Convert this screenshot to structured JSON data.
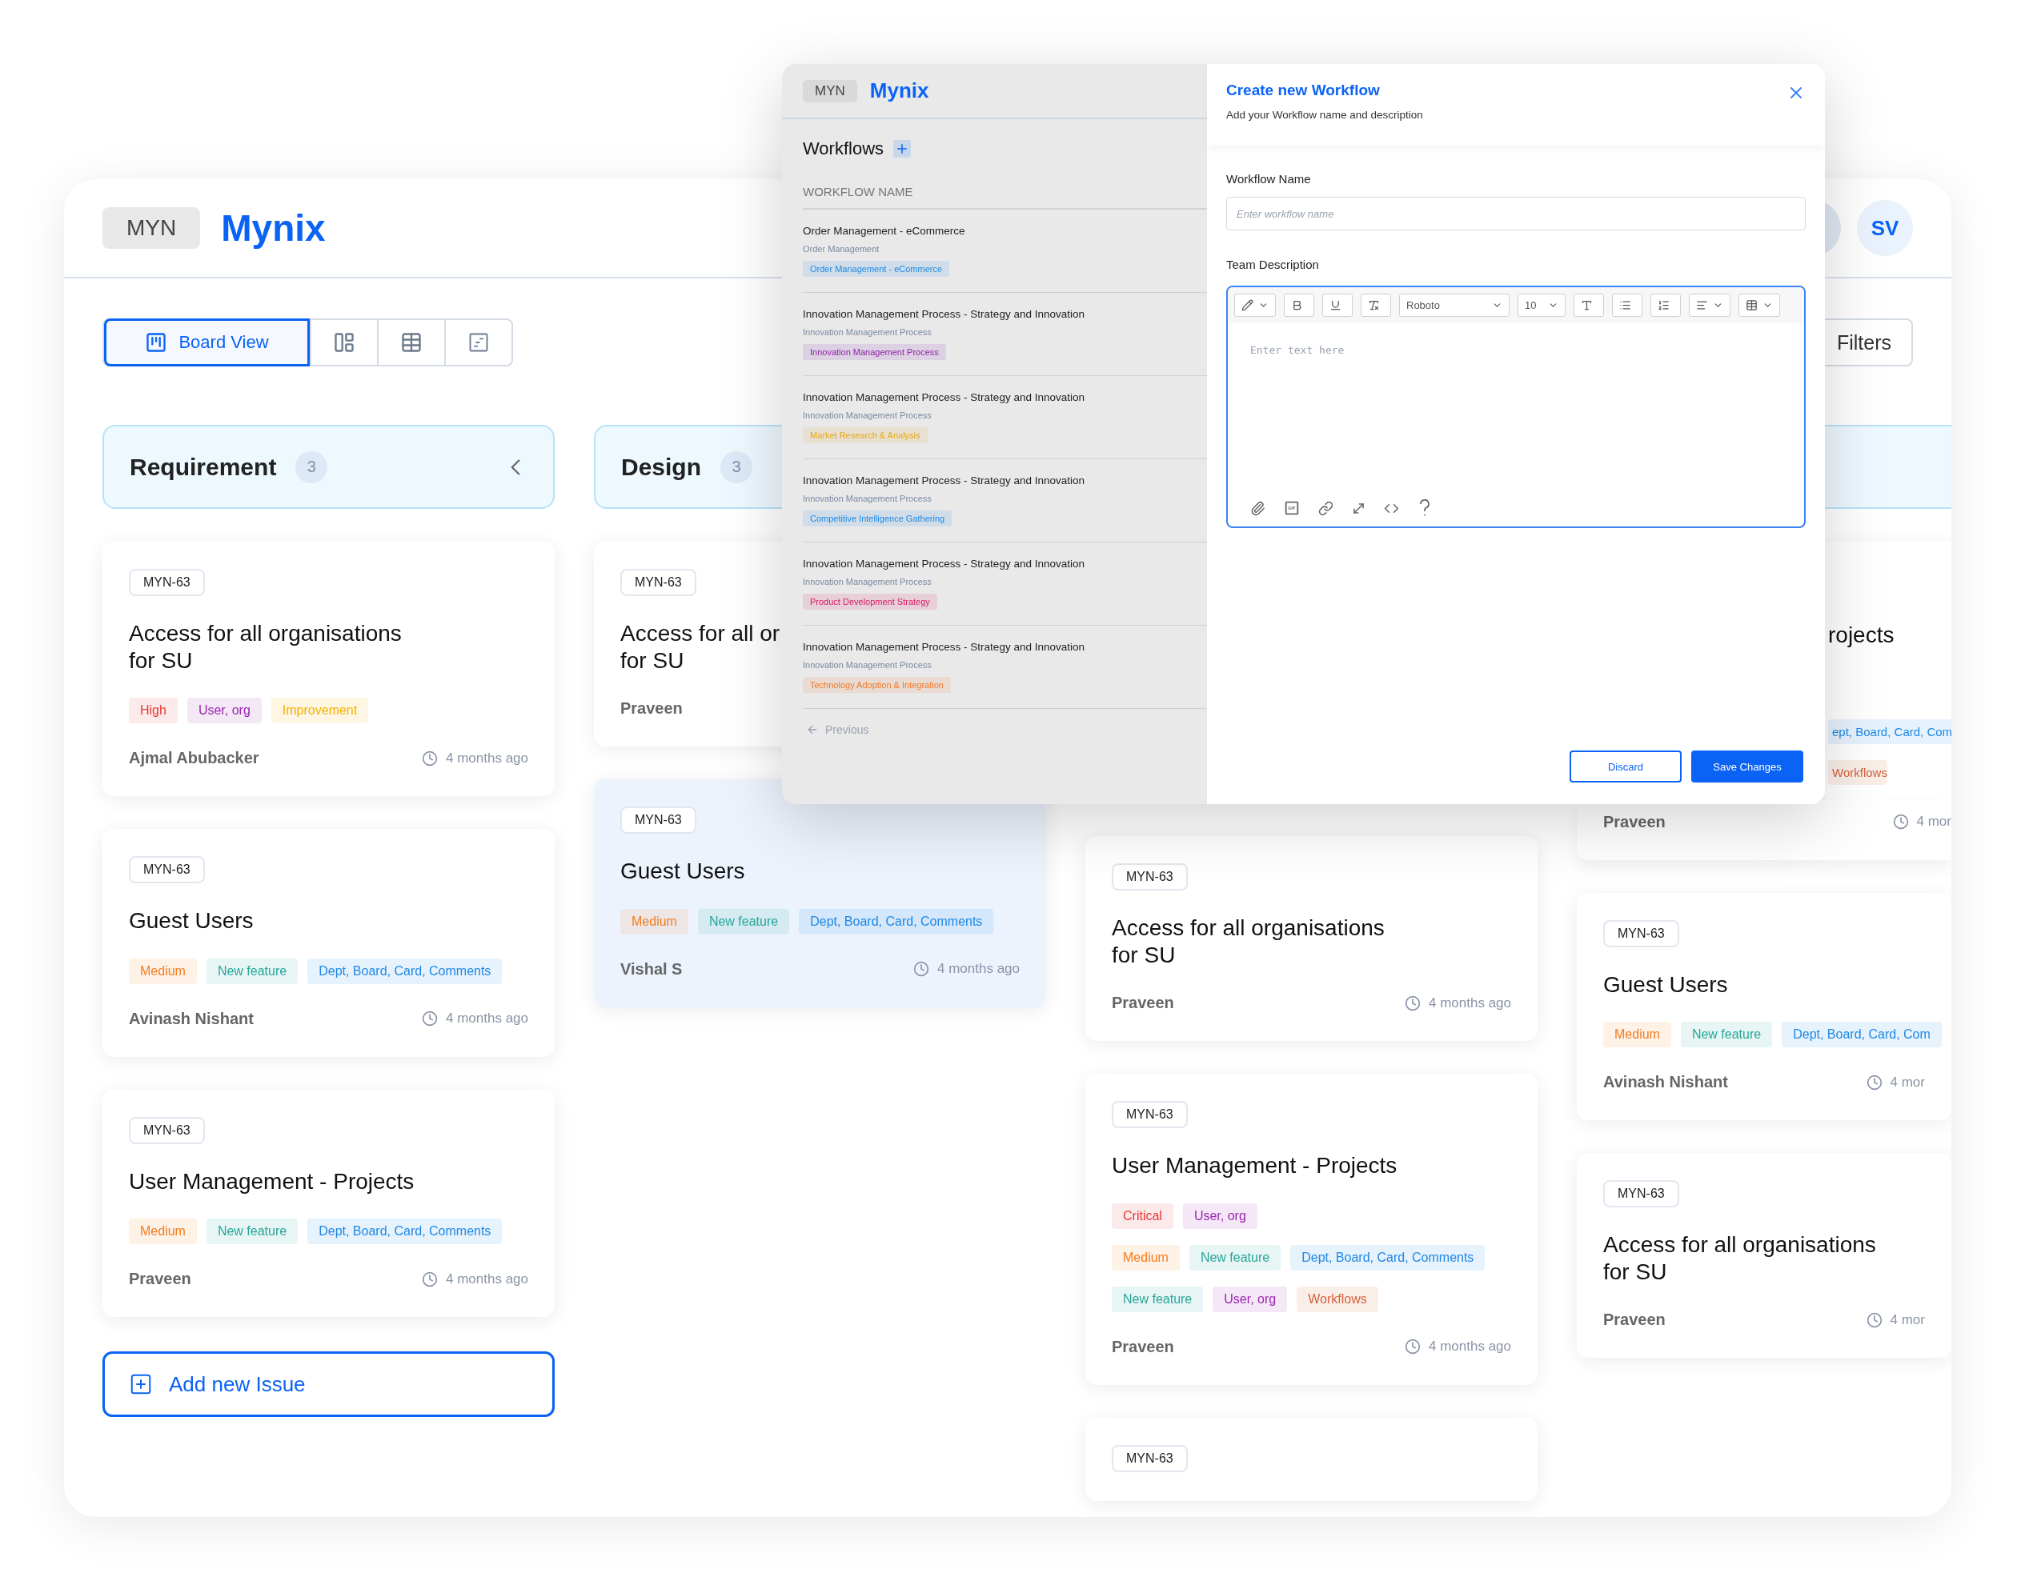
{
  "header": {
    "logo_badge": "MYN",
    "brand": "Mynix",
    "avatars": [
      {
        "initials": "SV"
      }
    ]
  },
  "toolbar": {
    "views": [
      {
        "kind": "board",
        "label": "Board View",
        "selected": true
      },
      {
        "kind": "split",
        "selected": false
      },
      {
        "kind": "table",
        "selected": false
      },
      {
        "kind": "timeline",
        "selected": false
      }
    ],
    "filters": "Filters"
  },
  "columns": [
    {
      "header": {
        "title": "Requirement",
        "count": "3",
        "collapse": true
      },
      "cards": [
        {
          "kind": "full",
          "id": "MYN-63",
          "title": "Access for all organisations\nfor SU",
          "highlighted": false,
          "tag_rows": [
            [
              {
                "label": "High",
                "color": "#e53935"
              },
              {
                "label": "User, org",
                "color": "#9c27b0"
              },
              {
                "label": "Improvement",
                "color": "#f5b000"
              }
            ]
          ],
          "author": "Ajmal Abubacker",
          "time": "4 months ago"
        },
        {
          "kind": "full",
          "id": "MYN-63",
          "title": "Guest Users",
          "highlighted": false,
          "tag_rows": [
            [
              {
                "label": "Medium",
                "color": "#f57c1f"
              },
              {
                "label": "New feature",
                "color": "#26a69a"
              },
              {
                "label": "Dept, Board, Card, Comments",
                "color": "#1e88e5"
              }
            ]
          ],
          "author": "Avinash Nishant",
          "time": "4 months ago"
        },
        {
          "kind": "full",
          "id": "MYN-63",
          "title": "User Management - Projects",
          "highlighted": false,
          "tag_rows": [
            [
              {
                "label": "Medium",
                "color": "#f57c1f"
              },
              {
                "label": "New feature",
                "color": "#26a69a"
              },
              {
                "label": "Dept, Board, Card, Comments",
                "color": "#1e88e5"
              }
            ]
          ],
          "author": "Praveen",
          "time": "4 months ago"
        }
      ],
      "add_button": "Add new Issue"
    },
    {
      "header": {
        "title": "Design",
        "count": "3"
      },
      "cards": [
        {
          "kind": "full",
          "id": "MYN-63",
          "title": "Access for all or\nfor SU",
          "highlighted": false,
          "author": "Praveen"
        },
        {
          "kind": "full",
          "id": "MYN-63",
          "title": "Guest Users",
          "highlighted": true,
          "tag_rows": [
            [
              {
                "label": "Medium",
                "color": "#f57c1f"
              },
              {
                "label": "New feature",
                "color": "#26a69a"
              },
              {
                "label": "Dept, Board, Card, Comments",
                "color": "#1e88e5"
              }
            ]
          ],
          "author": "Vishal S",
          "time": "4 months ago"
        }
      ]
    },
    {
      "cards": [
        {
          "kind": "full",
          "id": "MYN-63",
          "title": "Access for all organisations\nfor SU",
          "highlighted": false,
          "author": "Praveen",
          "time": "4 months ago"
        },
        {
          "kind": "full",
          "id": "MYN-63",
          "title": "User Management - Projects",
          "highlighted": false,
          "tag_rows": [
            [
              {
                "label": "Critical",
                "color": "#e53935"
              },
              {
                "label": "User, org",
                "color": "#9c27b0"
              }
            ],
            [
              {
                "label": "Medium",
                "color": "#f57c1f"
              },
              {
                "label": "New feature",
                "color": "#26a69a"
              },
              {
                "label": "Dept, Board, Card, Comments",
                "color": "#1e88e5"
              }
            ],
            [
              {
                "label": "New feature",
                "color": "#26a69a"
              },
              {
                "label": "User, org",
                "color": "#9c27b0"
              },
              {
                "label": "Workflows",
                "color": "#d4623a"
              }
            ]
          ],
          "author": "Praveen",
          "time": "4 months ago"
        },
        {
          "kind": "full",
          "id": "MYN-63",
          "highlighted": false
        }
      ]
    },
    {
      "header": {
        "collapse": false
      },
      "cards": [
        {
          "kind": "partial",
          "title": "rojects",
          "highlighted": false,
          "tag_rows": [
            [
              {
                "label": "ept, Board, Card, Com",
                "color": "#1e88e5"
              }
            ],
            [
              {
                "label": "Workflows",
                "color": "#d4623a"
              }
            ]
          ],
          "author": "Praveen",
          "time": "4 mor"
        },
        {
          "kind": "full",
          "id": "MYN-63",
          "title": "Guest Users",
          "highlighted": false,
          "tag_rows": [
            [
              {
                "label": "Medium",
                "color": "#f57c1f"
              },
              {
                "label": "New feature",
                "color": "#26a69a"
              },
              {
                "label": "Dept, Board, Card, Com",
                "color": "#1e88e5"
              }
            ]
          ],
          "author": "Avinash Nishant",
          "time": "4 mor"
        },
        {
          "kind": "full",
          "id": "MYN-63",
          "title": "Access for all organisations\nfor SU",
          "highlighted": false,
          "author": "Praveen",
          "time": "4 mor"
        }
      ]
    }
  ],
  "modal": {
    "sidebar": {
      "logo_badge": "MYN",
      "brand": "Mynix",
      "title": "Workflows",
      "column_header": "WORKFLOW NAME",
      "rows": [
        {
          "title": "Order Management - eCommerce",
          "subtitle": "Order Management",
          "tag": {
            "label": "Order Management - eCommerce",
            "color": "#1e88e5"
          }
        },
        {
          "title": "Innovation Management Process - Strategy and Innovation",
          "subtitle": "Innovation Management Process",
          "tag": {
            "label": "Innovation Management Process",
            "color": "#8e24aa"
          }
        },
        {
          "title": "Innovation Management Process - Strategy and Innovation",
          "subtitle": "Innovation Management Process",
          "tag": {
            "label": "Market Research & Analysis",
            "color": "#e6a817"
          }
        },
        {
          "title": "Innovation Management Process - Strategy and Innovation",
          "subtitle": "Innovation Management Process",
          "tag": {
            "label": "Competitive Intelligence Gathering",
            "color": "#1e88e5"
          }
        },
        {
          "title": "Innovation Management Process - Strategy and Innovation",
          "subtitle": "Innovation Management Process",
          "tag": {
            "label": "Product Development Strategy",
            "color": "#d81b60"
          }
        },
        {
          "title": "Innovation Management Process - Strategy and Innovation",
          "subtitle": "Innovation Management Process",
          "tag": {
            "label": "Technology Adoption & Integration",
            "color": "#ef7a2a"
          }
        }
      ],
      "previous": "Previous"
    },
    "form": {
      "title": "Create new Workflow",
      "subtitle": "Add your Workflow name and description",
      "name_field": {
        "label": "Workflow Name",
        "placeholder": "Enter workflow name"
      },
      "description_field": {
        "label": "Team Description",
        "font": "Roboto",
        "size": "10",
        "placeholder": "Enter text here"
      },
      "buttons": [
        {
          "kind": "secondary",
          "label": "Discard"
        },
        {
          "kind": "primary",
          "label": "Save Changes"
        }
      ]
    }
  }
}
